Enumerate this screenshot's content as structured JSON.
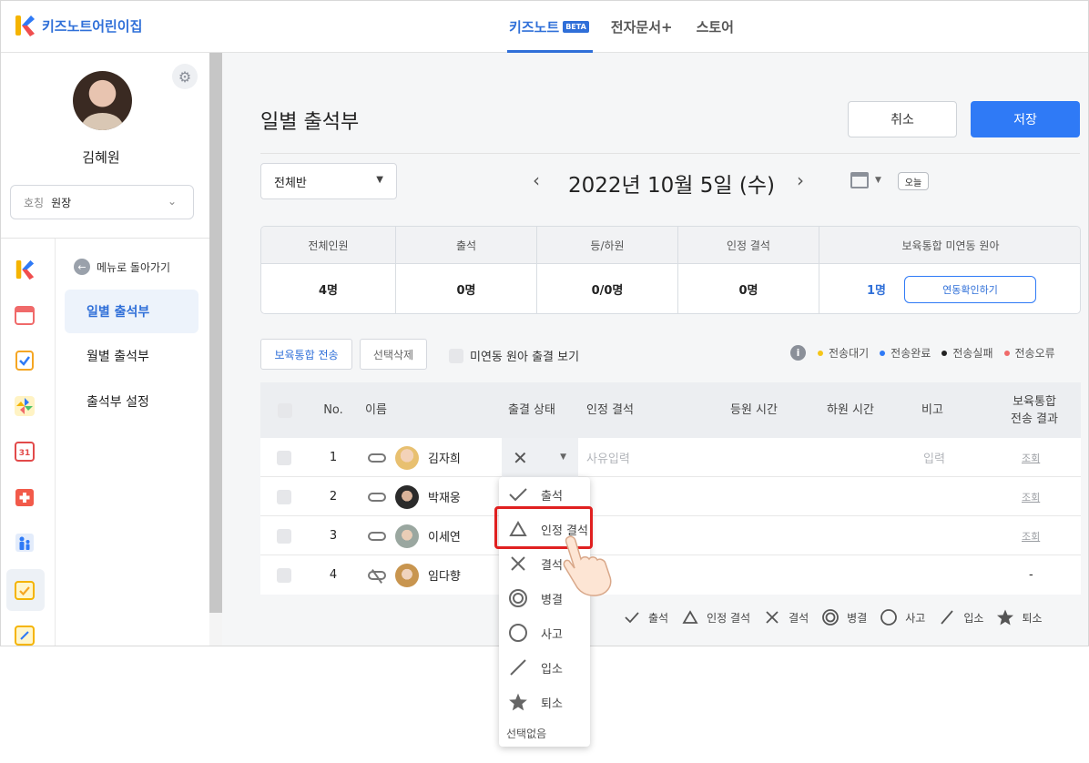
{
  "topbar": {
    "brand": "키즈노트어린이집",
    "tabs": [
      {
        "label": "키즈노트",
        "badge": "BETA"
      },
      {
        "label": "전자문서+"
      },
      {
        "label": "스토어"
      }
    ]
  },
  "sidebar": {
    "user_name": "김혜원",
    "role_key": "호칭",
    "role_value": "원장",
    "back_label": "메뉴로 돌아가기",
    "menu": [
      "일별 출석부",
      "월별 출석부",
      "출석부 설정"
    ]
  },
  "main": {
    "title": "일별 출석부",
    "cancel_label": "취소",
    "save_label": "저장",
    "class_select": "전체반",
    "date": "2022년 10월 5일 (수)",
    "today_label": "오늘"
  },
  "summary": {
    "headers": [
      "전체인원",
      "출석",
      "등/하원",
      "인정 결석",
      "보육통합 미연동 원아"
    ],
    "values": [
      "4명",
      "0명",
      "0/0명",
      "0명",
      "1명"
    ],
    "link_button": "연동확인하기"
  },
  "actions": {
    "send_label": "보육통합 전송",
    "delete_label": "선택삭제",
    "unlinked_label": "미연동 원아 출결 보기"
  },
  "legend_top": [
    {
      "label": "전송대기",
      "color": "#f5c518"
    },
    {
      "label": "전송완료",
      "color": "#2f7af6"
    },
    {
      "label": "전송실패",
      "color": "#222222"
    },
    {
      "label": "전송오류",
      "color": "#f06a6a"
    }
  ],
  "table": {
    "headers": [
      "No.",
      "이름",
      "출결 상태",
      "인정 결석",
      "등원 시간",
      "하원 시간",
      "비고",
      "보육통합",
      "전송 결과"
    ],
    "rows": [
      {
        "no": "1",
        "name": "김자희",
        "reason_placeholder": "사유입력",
        "note_placeholder": "입력",
        "result": "조회"
      },
      {
        "no": "2",
        "name": "박재웅",
        "result": "조회"
      },
      {
        "no": "3",
        "name": "이세연",
        "result": "조회"
      },
      {
        "no": "4",
        "name": "임다향",
        "result": "-"
      }
    ]
  },
  "dropdown": {
    "items": [
      {
        "label": "출석",
        "icon": "check-icon"
      },
      {
        "label": "인정 결석",
        "icon": "triangle-icon"
      },
      {
        "label": "결석",
        "icon": "x-icon"
      },
      {
        "label": "병결",
        "icon": "double-circle-icon"
      },
      {
        "label": "사고",
        "icon": "circle-icon"
      },
      {
        "label": "입소",
        "icon": "slash-icon"
      },
      {
        "label": "퇴소",
        "icon": "star-icon"
      }
    ],
    "none_label": "선택없음"
  },
  "legend_bottom": [
    {
      "label": "출석",
      "icon": "check-icon"
    },
    {
      "label": "인정 결석",
      "icon": "triangle-icon"
    },
    {
      "label": "결석",
      "icon": "x-icon"
    },
    {
      "label": "병결",
      "icon": "double-circle-icon"
    },
    {
      "label": "사고",
      "icon": "circle-icon"
    },
    {
      "label": "입소",
      "icon": "slash-icon"
    },
    {
      "label": "퇴소",
      "icon": "star-icon"
    }
  ]
}
